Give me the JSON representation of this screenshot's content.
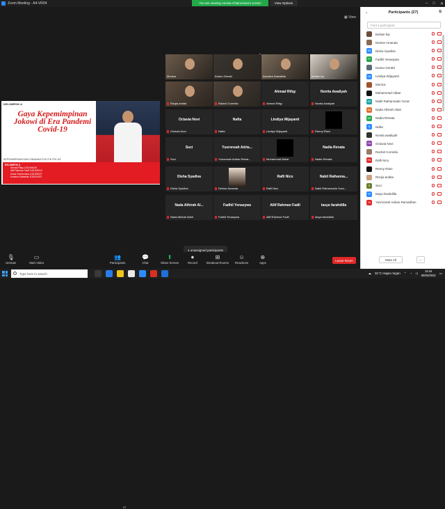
{
  "titlebar": {
    "app_title": "Zoom Meeting - A4-VR04",
    "viewing_banner": "You are viewing Annisa Chairunnisa's screen",
    "view_options": "View Options"
  },
  "stage": {
    "view_label": "View"
  },
  "slide": {
    "kelompok": "KELOMPOK A",
    "headline": "Gaya Kepemimpinan Jokowi di Era Pandemi Covid-19",
    "subtitle": "KEPEMIMPINAN DAN DINAMIKA POLITIK POL B2",
    "group_title": "KELOMPOK A",
    "members": [
      "Ahmad Rifqy 1151004026",
      "Allif Rahman Fadil 1151004013",
      "Anisa Chairunnisa 1151004027",
      "Azzahra Salsabila 1151004007"
    ]
  },
  "gallery": [
    {
      "display": "Monica",
      "label": "Monica",
      "video": true,
      "muted": false
    },
    {
      "display": "Keanu Gerald",
      "label": "Keanu Gerald",
      "video": true,
      "muted": false
    },
    {
      "display": "Azzahra Salsabilla",
      "label": "Azzahra Salsabilla",
      "video": true,
      "muted": false
    },
    {
      "display": "berlian fvp",
      "label": "berlian fvp",
      "video": true,
      "muted": false
    },
    {
      "display": "Rizqia andita",
      "label": "Rizqia andita",
      "video": true,
      "muted": true
    },
    {
      "display": "Rachel Cornelia",
      "label": "Rachel Cornelia",
      "video": true,
      "muted": true
    },
    {
      "display": "Ahmad Rifqy",
      "label": "Ahmad Rifqy",
      "video": false,
      "muted": true
    },
    {
      "display": "Novita Awaliyah",
      "label": "Novita Awaliyah",
      "video": false,
      "muted": true
    },
    {
      "display": "Octavia Novi",
      "label": "Octavia Novi",
      "video": false,
      "muted": true
    },
    {
      "display": "Nafta",
      "label": "Nafta",
      "video": false,
      "muted": true
    },
    {
      "display": "Lindiya Wijayanti",
      "label": "Lindiya Wijayanti",
      "video": false,
      "muted": true
    },
    {
      "display": "",
      "label": "Renny Riani",
      "video": false,
      "muted": true,
      "black": true
    },
    {
      "display": "Suci",
      "label": "Suci",
      "video": false,
      "muted": true
    },
    {
      "display": "Yusronsah Adria...",
      "label": "Yusronsah Adrian Rama...",
      "video": false,
      "muted": true
    },
    {
      "display": "",
      "label": "Muhammad Akbar",
      "video": false,
      "muted": true,
      "black": true
    },
    {
      "display": "Nadia Renata",
      "label": "Nadia Renata",
      "video": false,
      "muted": true
    },
    {
      "display": "Disha Syadiva",
      "label": "Disha Syadiva",
      "video": false,
      "muted": true
    },
    {
      "display": "",
      "label": "Denise Amanda",
      "video": true,
      "muted": true,
      "portrait": true
    },
    {
      "display": "Rafli Nico",
      "label": "Rafli Nico",
      "video": false,
      "muted": true
    },
    {
      "display": "Nabil Raihanna...",
      "label": "Nabil Raihannada Yuza...",
      "video": false,
      "muted": true
    },
    {
      "display": "Nada Athirah Al...",
      "label": "Nada Athirah Aliati",
      "video": false,
      "muted": true
    },
    {
      "display": "Fadhil Yenasywa",
      "label": "Fadhil Yenasywa",
      "video": false,
      "muted": true
    },
    {
      "display": "Allif Rahman Fadil",
      "label": "Allif Rahman Fadil",
      "video": false,
      "muted": true
    },
    {
      "display": "tasya farahdilla",
      "label": "tasya farahdilla",
      "video": false,
      "muted": true
    }
  ],
  "unassigned": "4 unassigned participants",
  "toolbar": {
    "unmute": "Unmute",
    "start_video": "Start Video",
    "participants": "Participants",
    "participants_count": "27",
    "chat": "Chat",
    "share_screen": "Share Screen",
    "record": "Record",
    "breakout": "Breakout Rooms",
    "reactions": "Reactions",
    "apps": "Apps",
    "leave": "Leave Room"
  },
  "panel": {
    "title": "Participants (27)",
    "search_placeholder": "Find a participant",
    "mute_all": "Mute All",
    "more": "...",
    "participants": [
      {
        "name": "berlian fvp",
        "initials": "",
        "color": "#6b4f3a"
      },
      {
        "name": "Denise Amanda",
        "initials": "",
        "color": "#8a6a55"
      },
      {
        "name": "Disha Syadiva",
        "initials": "DS",
        "color": "#2d8cff"
      },
      {
        "name": "Fadhil Yenasywa",
        "initials": "FY",
        "color": "#23a94a"
      },
      {
        "name": "Keanu Gerald",
        "initials": "",
        "color": "#5a6b7a"
      },
      {
        "name": "Lindiya Wijayanti",
        "initials": "LW",
        "color": "#2d8cff"
      },
      {
        "name": "Monica",
        "initials": "",
        "color": "#a0522d"
      },
      {
        "name": "Muhammad Akbar",
        "initials": "",
        "color": "#111111"
      },
      {
        "name": "Nabil Raihannada Yuzan",
        "initials": "NR",
        "color": "#1fa3a3"
      },
      {
        "name": "Nada Athirah Aliati",
        "initials": "NA",
        "color": "#e0702c"
      },
      {
        "name": "Nadia Renata",
        "initials": "NR",
        "color": "#23a94a"
      },
      {
        "name": "Nafta",
        "initials": "N",
        "color": "#2d8cff"
      },
      {
        "name": "Novita awaliyah",
        "initials": "",
        "color": "#333333"
      },
      {
        "name": "Octavia Novi",
        "initials": "ON",
        "color": "#8e44ad"
      },
      {
        "name": "Rachel Cornelia",
        "initials": "",
        "color": "#9a7a6a"
      },
      {
        "name": "Rafli Nico",
        "initials": "RN",
        "color": "#e02828"
      },
      {
        "name": "Renny Riani",
        "initials": "",
        "color": "#111111"
      },
      {
        "name": "Rizqia andita",
        "initials": "",
        "color": "#c8a080"
      },
      {
        "name": "Suci",
        "initials": "S",
        "color": "#6a7f2a"
      },
      {
        "name": "tasya farahdilla",
        "initials": "TF",
        "color": "#2d8cff"
      },
      {
        "name": "Yusronsah Adrian Ramadhan",
        "initials": "YA",
        "color": "#e02828"
      }
    ]
  },
  "taskbar": {
    "search_placeholder": "Type here to search",
    "weather": "31°C Hujan ringan",
    "time": "15:44",
    "date": "06/04/2022"
  }
}
